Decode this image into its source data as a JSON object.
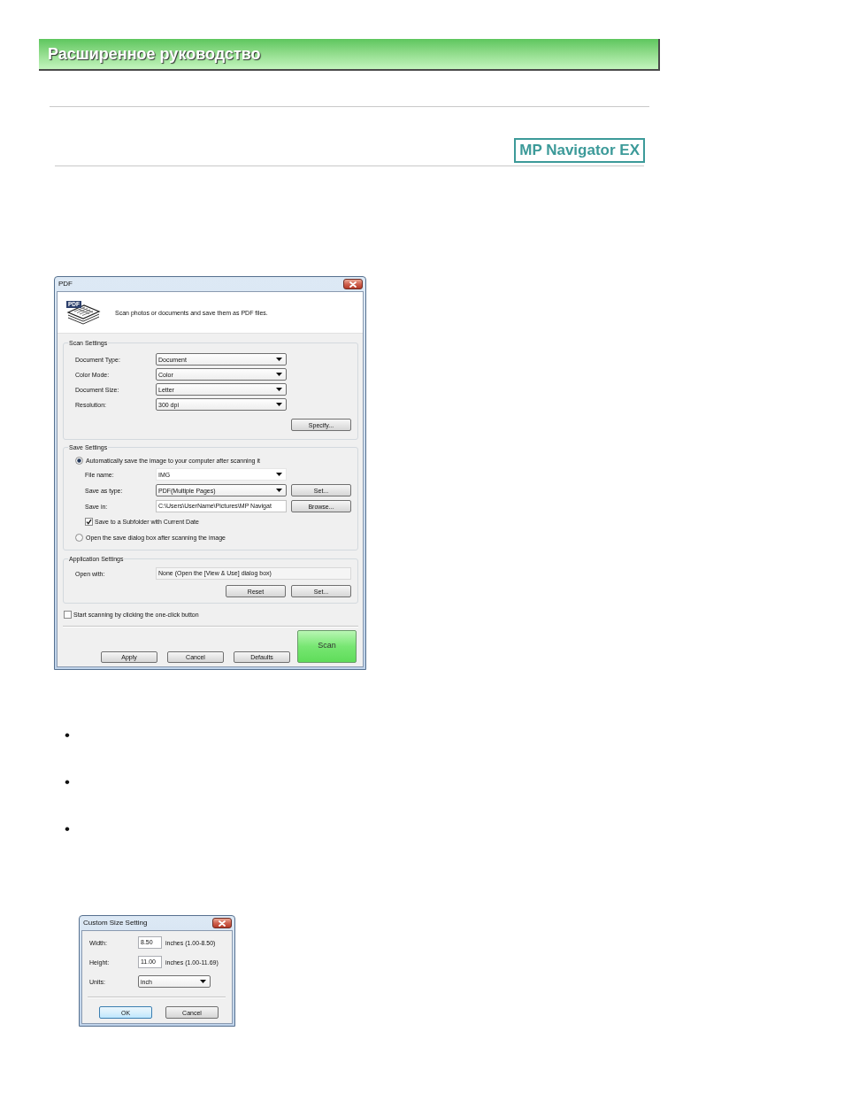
{
  "header": {
    "title": "Расширенное руководство"
  },
  "product_logo": {
    "text": "MP Navigator EX"
  },
  "pdf_dialog": {
    "title": "PDF",
    "icon_tag": "PDF",
    "description": "Scan photos or documents and save them as PDF files.",
    "scan_settings": {
      "title": "Scan Settings",
      "fields": [
        {
          "label": "Document Type:",
          "value": "Document"
        },
        {
          "label": "Color Mode:",
          "value": "Color"
        },
        {
          "label": "Document Size:",
          "value": "Letter"
        },
        {
          "label": "Resolution:",
          "value": "300 dpi"
        }
      ],
      "button": "Specify..."
    },
    "save_settings": {
      "title": "Save Settings",
      "options": [
        {
          "label": "Automatically save the image to your computer after scanning it",
          "selected": true,
          "fields": [
            {
              "kind": "combo",
              "label": "File name:",
              "value": "IMG"
            },
            {
              "kind": "select",
              "label": "Save as type:",
              "value": "PDF(Multiple Pages)",
              "button": "Set..."
            },
            {
              "kind": "path",
              "label": "Save in:",
              "value": "C:\\Users\\UserName\\Pictures\\MP Navigat",
              "button": "Browse..."
            }
          ],
          "subfolder": {
            "label": "Save to a Subfolder with Current Date",
            "checked": true
          }
        },
        {
          "label": "Open the save dialog box after scanning the image",
          "selected": false
        }
      ]
    },
    "application_settings": {
      "title": "Application Settings",
      "open_with": {
        "label": "Open with:",
        "value": "None (Open the [View & Use] dialog box)"
      },
      "buttons": [
        "Reset",
        "Set..."
      ]
    },
    "one_click": {
      "label": "Start scanning by clicking the one-click button",
      "checked": false
    },
    "buttons": [
      "Apply",
      "Cancel",
      "Defaults"
    ],
    "scan_button": {
      "label": "Scan"
    }
  },
  "bullet_list": [
    {
      "marker": "•"
    },
    {
      "marker": "•"
    },
    {
      "marker": "•"
    }
  ],
  "custom_size_dialog": {
    "title": "Custom Size Setting",
    "fields": [
      {
        "kind": "input",
        "label": "Width:",
        "value": "8.50",
        "range": "inches (1.00-8.50)"
      },
      {
        "kind": "input",
        "label": "Height:",
        "value": "11.00",
        "range": "inches (1.00-11.69)"
      },
      {
        "kind": "select",
        "label": "Units:",
        "value": "inch"
      }
    ],
    "buttons": [
      {
        "label": "OK",
        "default": true
      },
      {
        "label": "Cancel",
        "default": false
      }
    ]
  }
}
